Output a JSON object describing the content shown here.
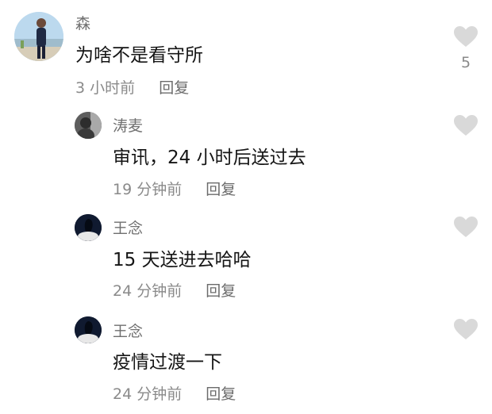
{
  "colors": {
    "heart": "#d9d9d9",
    "name": "#6f6f6f",
    "text": "#151515",
    "meta": "#8a8a8a"
  },
  "comments": [
    {
      "username": "森",
      "text": "为啥不是看守所",
      "time": "3 小时前",
      "reply_label": "回复",
      "like_icon": "heart-icon",
      "likes": "5"
    },
    {
      "username": "涛麦",
      "text": "审讯，24 小时后送过去",
      "time": "19 分钟前",
      "reply_label": "回复",
      "like_icon": "heart-icon"
    },
    {
      "username": "王念",
      "text": "15 天送进去哈哈",
      "time": "24 分钟前",
      "reply_label": "回复",
      "like_icon": "heart-icon"
    },
    {
      "username": "王念",
      "text": "疫情过渡一下",
      "time": "24 分钟前",
      "reply_label": "回复",
      "like_icon": "heart-icon"
    }
  ]
}
